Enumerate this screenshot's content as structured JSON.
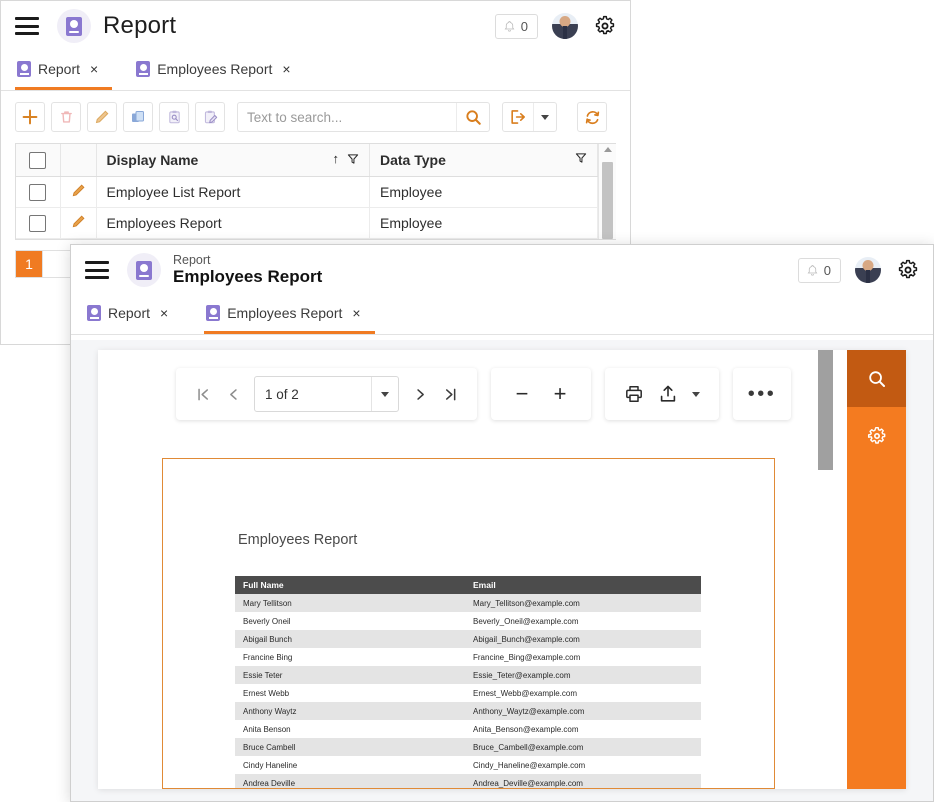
{
  "back_window": {
    "header": {
      "menu_icon": "hamburger-icon",
      "logo_icon": "report-logo-icon",
      "title": "Report",
      "notification_icon": "bell-icon",
      "notification_count": "0",
      "avatar_icon": "user-avatar",
      "settings_icon": "gear-icon"
    },
    "tabs": [
      {
        "label": "Report",
        "icon": "report-tab-icon",
        "close": "×",
        "active": true
      },
      {
        "label": "Employees Report",
        "icon": "report-tab-icon",
        "close": "×",
        "active": false
      }
    ],
    "toolbar": {
      "add_label": "+",
      "add_icon": "plus-icon",
      "delete_icon": "trash-icon",
      "edit_icon": "pencil-icon",
      "copy_icon": "copy-icon",
      "inspect_icon": "clipboard-search-icon",
      "clipboard_edit_icon": "clipboard-edit-icon",
      "search_icon": "search-icon",
      "export_icon": "export-icon",
      "export_dropdown_icon": "chevron-down-icon",
      "refresh_icon": "refresh-icon"
    },
    "search": {
      "placeholder": "Text to search...",
      "value": ""
    },
    "grid": {
      "columns": [
        "Display Name",
        "Data Type"
      ],
      "sort_icon": "sort-asc-icon",
      "filter_icon": "filter-icon",
      "rows": [
        {
          "display_name": "Employee List Report",
          "data_type": "Employee"
        },
        {
          "display_name": "Employees Report",
          "data_type": "Employee"
        }
      ]
    },
    "pager": {
      "current_page": "1"
    }
  },
  "front_window": {
    "header": {
      "menu_icon": "hamburger-icon",
      "logo_icon": "report-logo-icon",
      "breadcrumb": "Report",
      "title": "Employees Report",
      "notification_icon": "bell-icon",
      "notification_count": "0",
      "avatar_icon": "user-avatar",
      "settings_icon": "gear-icon"
    },
    "tabs": [
      {
        "label": "Report",
        "icon": "report-tab-icon",
        "close": "×",
        "active": false
      },
      {
        "label": "Employees Report",
        "icon": "report-tab-icon",
        "close": "×",
        "active": true
      }
    ],
    "viewer_toolbar": {
      "first_page_icon": "first-page-icon",
      "prev_page_icon": "previous-page-icon",
      "page_value": "1 of 2",
      "page_dropdown_icon": "chevron-down-icon",
      "next_page_icon": "next-page-icon",
      "last_page_icon": "last-page-icon",
      "zoom_out_label": "−",
      "zoom_out_icon": "zoom-out-icon",
      "zoom_in_label": "+",
      "zoom_in_icon": "zoom-in-icon",
      "print_icon": "print-icon",
      "export_icon": "export-upload-icon",
      "export_dropdown_icon": "chevron-down-icon",
      "more_label": "•••",
      "more_icon": "more-options-icon"
    },
    "document": {
      "title": "Employees Report",
      "columns": [
        "Full Name",
        "Email"
      ],
      "rows": [
        {
          "full_name": "Mary Tellitson",
          "email": "Mary_Tellitson@example.com"
        },
        {
          "full_name": "Beverly Oneil",
          "email": "Beverly_Oneil@example.com"
        },
        {
          "full_name": "Abigail Bunch",
          "email": "Abigail_Bunch@example.com"
        },
        {
          "full_name": "Francine Bing",
          "email": "Francine_Bing@example.com"
        },
        {
          "full_name": "Essie Teter",
          "email": "Essie_Teter@example.com"
        },
        {
          "full_name": "Ernest Webb",
          "email": "Ernest_Webb@example.com"
        },
        {
          "full_name": "Anthony Waytz",
          "email": "Anthony_Waytz@example.com"
        },
        {
          "full_name": "Anita Benson",
          "email": "Anita_Benson@example.com"
        },
        {
          "full_name": "Bruce Cambell",
          "email": "Bruce_Cambell@example.com"
        },
        {
          "full_name": "Cindy Haneline",
          "email": "Cindy_Haneline@example.com"
        },
        {
          "full_name": "Andrea Deville",
          "email": "Andrea_Deville@example.com"
        }
      ]
    },
    "action_rail": {
      "search_icon": "search-icon",
      "settings_icon": "gear-icon"
    }
  },
  "colors": {
    "accent_orange": "#f07b22",
    "rail_orange": "#f47b20",
    "rail_orange_dark": "#c25a12",
    "logo_purple": "#8a78d0",
    "doc_header_gray": "#4c4c4c",
    "doc_border": "#e08a36"
  }
}
